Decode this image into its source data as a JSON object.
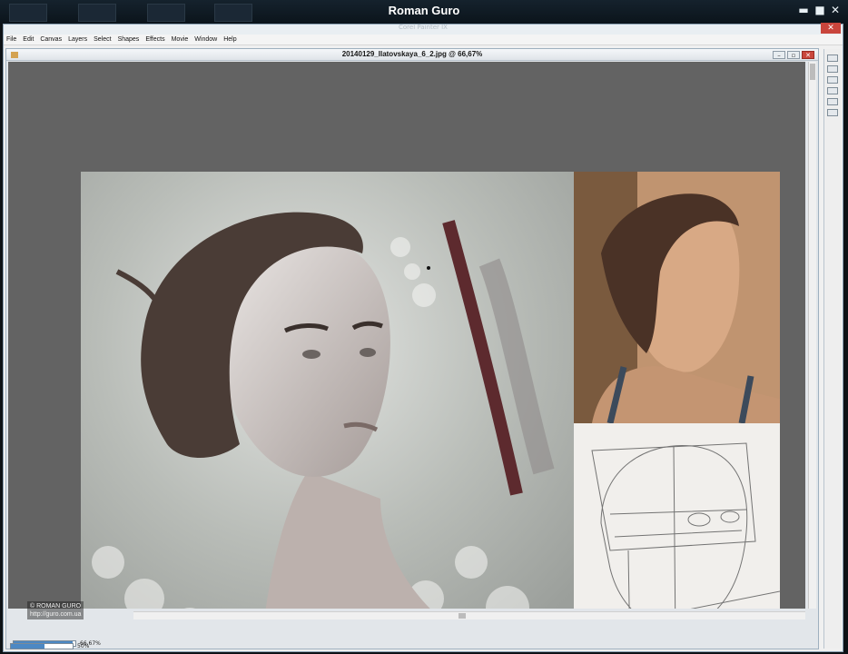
{
  "window": {
    "title": "Roman Guro",
    "minimize": "▬",
    "maximize": "■",
    "close": "✕"
  },
  "app": {
    "title": "Corel Painter IX",
    "close": "✕"
  },
  "menu": [
    "File",
    "Edit",
    "Canvas",
    "Layers",
    "Select",
    "Shapes",
    "Effects",
    "Movie",
    "Window",
    "Help"
  ],
  "document": {
    "title": "20140129_Ilatovskaya_6_2.jpg @ 66,67%",
    "min": "–",
    "restore": "▫",
    "close": "✕"
  },
  "status": {
    "zoom_primary": "66,67%",
    "zoom_secondary": "50%",
    "zoom_primary_fill": 0.95,
    "zoom_secondary_fill": 0.55
  },
  "watermark": {
    "line1": "© ROMAN GURO",
    "line2": "http://guro.com.ua"
  },
  "colors": {
    "canvas_bg": "#636363",
    "accent": "#4c88c4",
    "close_red": "#c9473d"
  }
}
